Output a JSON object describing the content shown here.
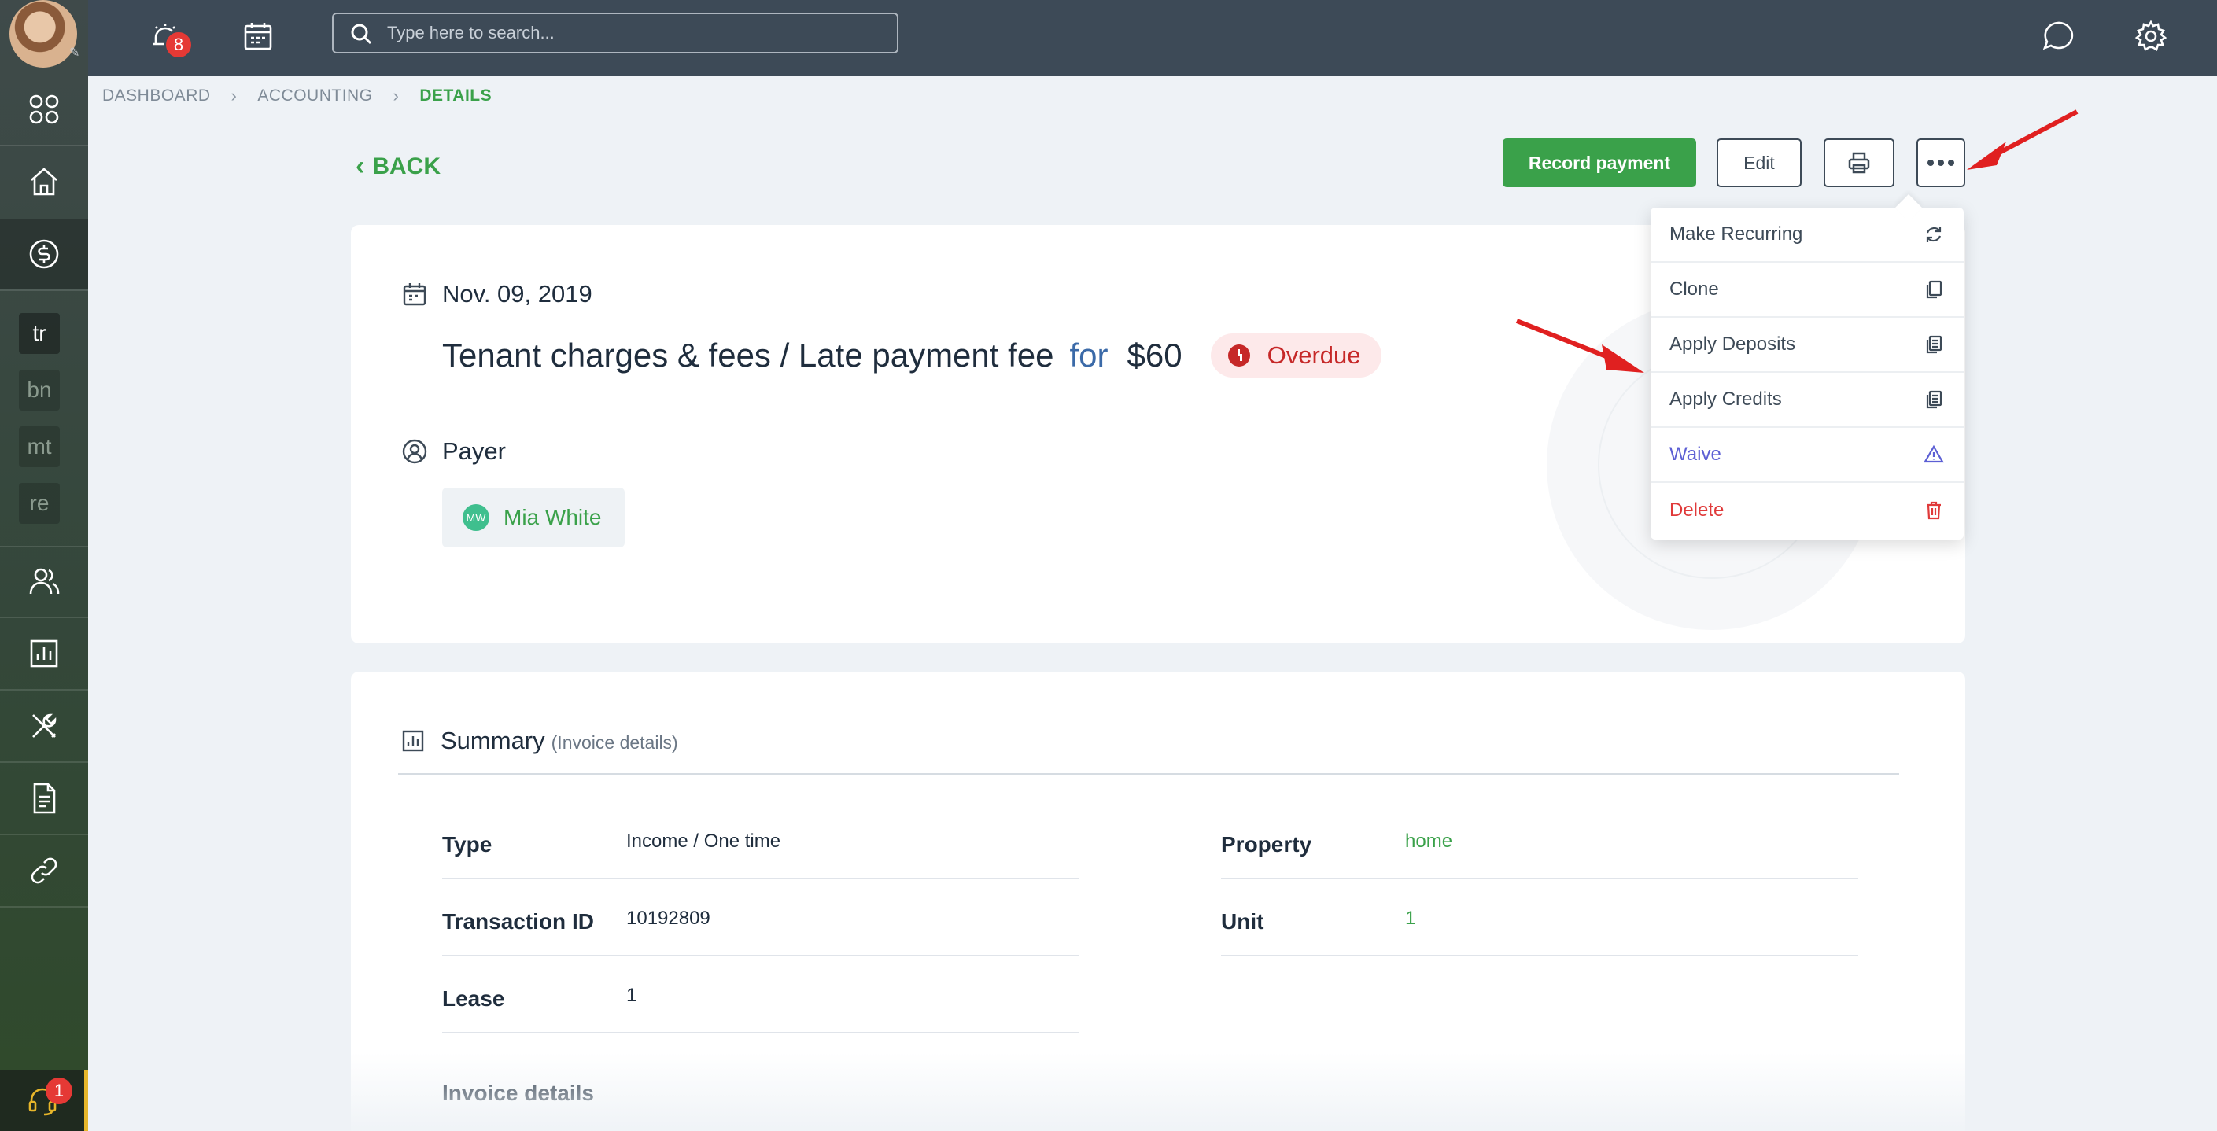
{
  "sidebar": {
    "abbreviations": [
      "tr",
      "bn",
      "mt",
      "re"
    ],
    "support_badge": "1"
  },
  "topbar": {
    "notification_count": "8",
    "search_placeholder": "Type here to search..."
  },
  "breadcrumb": {
    "items": [
      "DASHBOARD",
      "ACCOUNTING",
      "DETAILS"
    ]
  },
  "back_label": "BACK",
  "actions": {
    "record_payment": "Record payment",
    "edit": "Edit"
  },
  "menu": {
    "items": [
      "Make Recurring",
      "Clone",
      "Apply Deposits",
      "Apply Credits",
      "Waive",
      "Delete"
    ]
  },
  "invoice": {
    "date": "Nov. 09, 2019",
    "title": "Tenant charges & fees / Late payment fee",
    "for_word": "for",
    "amount": "$60",
    "status": "Overdue",
    "payer_label": "Payer",
    "payer_initials": "MW",
    "payer_name": "Mia White"
  },
  "summary": {
    "title": "Summary",
    "subtitle": "(Invoice details)",
    "left_fields": [
      {
        "label": "Type",
        "value": "Income / One time"
      },
      {
        "label": "Transaction ID",
        "value": "10192809"
      },
      {
        "label": "Lease",
        "value": "1"
      }
    ],
    "right_fields": [
      {
        "label": "Property",
        "value": "home"
      },
      {
        "label": "Unit",
        "value": "1"
      }
    ],
    "invoice_details_label": "Invoice details"
  },
  "colors": {
    "accent_green": "#3aa14a",
    "topbar": "#3d4a57",
    "overdue_red": "#c62828",
    "waive_purple": "#5c5fd4",
    "delete_red": "#e03a3a",
    "annotation_arrow": "#e02020"
  }
}
